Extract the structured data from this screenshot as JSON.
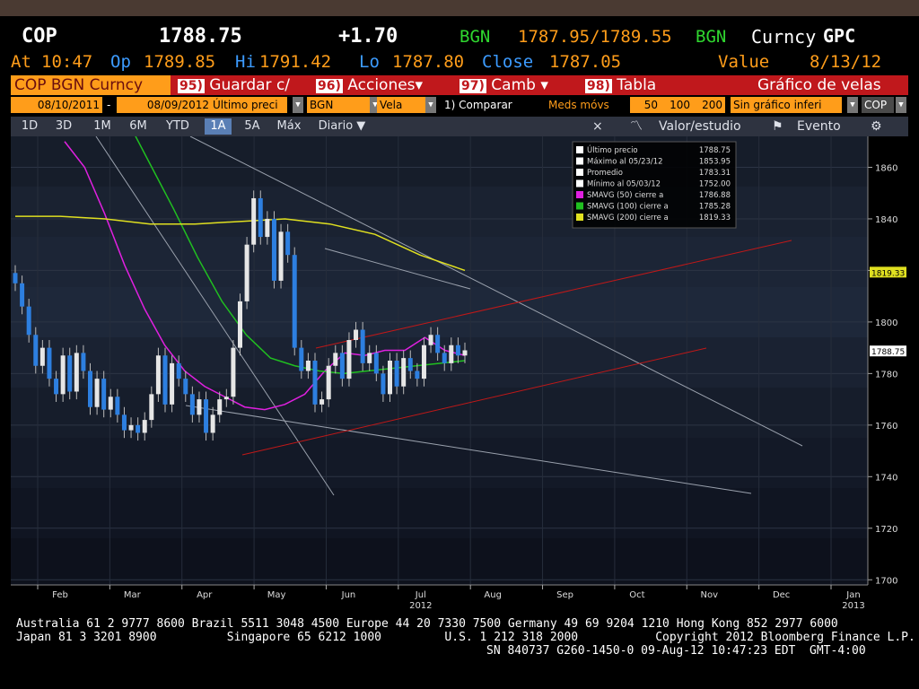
{
  "header": {
    "ticker": "COP",
    "last": "1788.75",
    "change": "+1.70",
    "source1": "BGN",
    "bidask": "1787.95/1789.55",
    "source2": "BGN",
    "curncy": "Curncy",
    "gpc": "GPC",
    "at_label": "At",
    "time": "10:47",
    "op_label": "Op",
    "op": "1789.85",
    "hi_label": "Hi",
    "hi": "1791.42",
    "lo_label": "Lo",
    "lo": "1787.80",
    "close_label": "Close",
    "close": "1787.05",
    "value_label": "Value",
    "date": "8/13/12"
  },
  "menu": {
    "security": "COP BGN Curncy",
    "items": [
      {
        "num": "95)",
        "label": "Guardar c/"
      },
      {
        "num": "96)",
        "label": "Acciones"
      },
      {
        "num": "97)",
        "label": "Camb"
      },
      {
        "num": "98)",
        "label": "Tabla"
      }
    ],
    "title": "Gráfico de velas"
  },
  "controls": {
    "start": "08/10/2011",
    "dash": "-",
    "end": "08/09/2012",
    "field": "Último preci",
    "source": "BGN",
    "style": "Vela",
    "compare": "1) Comparar",
    "mavg_label": "Meds móvs",
    "mavg1": "50",
    "mavg2": "100",
    "mavg3": "200",
    "lower": "Sin gráfico inferi",
    "ccy": "COP"
  },
  "tabs": [
    "1D",
    "3D",
    "1M",
    "6M",
    "YTD",
    "1A",
    "5A",
    "Máx"
  ],
  "selected_tab": "1A",
  "period": "Diario ▼",
  "tools": {
    "value_study": "Valor/estudio",
    "event": "Evento",
    "close": "×"
  },
  "legend": [
    {
      "label": "Último precio",
      "value": "1788.75",
      "color": "#ffffff"
    },
    {
      "label": "Máximo al 05/23/12",
      "value": "1853.95",
      "color": "#ffffff"
    },
    {
      "label": "Promedio",
      "value": "1783.31",
      "color": "#ffffff"
    },
    {
      "label": "Mínimo al 05/03/12",
      "value": "1752.00",
      "color": "#ffffff"
    },
    {
      "label": "SMAVG (50) cierre a",
      "value": "1786.88",
      "color": "#e020e0"
    },
    {
      "label": "SMAVG (100) cierre a",
      "value": "1785.28",
      "color": "#20c020"
    },
    {
      "label": "SMAVG (200) cierre a",
      "value": "1819.33",
      "color": "#e0e020"
    }
  ],
  "chart_data": {
    "type": "candlestick",
    "x_labels": [
      "Feb",
      "Mar",
      "Apr",
      "May",
      "Jun",
      "Jul",
      "Aug",
      "Sep",
      "Oct",
      "Nov",
      "Dec",
      "Jan"
    ],
    "year_labels": {
      "Jul": "2012",
      "Jan": "2013"
    },
    "y_ticks": [
      1700,
      1720,
      1740,
      1760,
      1780,
      1800,
      1820,
      1840,
      1860
    ],
    "ylim": [
      1698,
      1872
    ],
    "last_tag": "1788.75",
    "smavg200_tag": "1819.33",
    "close_series": [
      1815,
      1806,
      1795,
      1783,
      1790,
      1778,
      1772,
      1787,
      1773,
      1788,
      1781,
      1767,
      1778,
      1766,
      1771,
      1764,
      1758,
      1760,
      1757,
      1762,
      1772,
      1787,
      1768,
      1784,
      1778,
      1772,
      1764,
      1770,
      1757,
      1764,
      1770,
      1771,
      1790,
      1808,
      1830,
      1848,
      1833,
      1840,
      1816,
      1835,
      1826,
      1790,
      1781,
      1785,
      1768,
      1770,
      1783,
      1788,
      1778,
      1793,
      1797,
      1784,
      1788,
      1780,
      1772,
      1785,
      1775,
      1786,
      1781,
      1778,
      1791,
      1795,
      1788,
      1784,
      1791,
      1787,
      1789
    ],
    "series": [
      {
        "name": "SMAVG (50)",
        "color": "#e020e0",
        "values": [
          1870,
          1860,
          1842,
          1822,
          1805,
          1791,
          1781,
          1775,
          1771,
          1767,
          1766,
          1768,
          1772,
          1781,
          1788,
          1787,
          1789,
          1789,
          1794,
          1789,
          1787
        ]
      },
      {
        "name": "SMAVG (100)",
        "color": "#20c020",
        "values": [
          1890,
          1880,
          1862,
          1844,
          1825,
          1808,
          1795,
          1786,
          1783,
          1781,
          1780,
          1781,
          1782,
          1783,
          1784,
          1785
        ]
      },
      {
        "name": "SMAVG (200)",
        "color": "#e0e020",
        "values": [
          1841,
          1841,
          1840,
          1838,
          1838,
          1839,
          1840,
          1838,
          1834,
          1826,
          1820
        ]
      }
    ]
  },
  "footer": {
    "line1": "Australia 61 2 9777 8600 Brazil 5511 3048 4500 Europe 44 20 7330 7500 Germany 49 69 9204 1210 Hong Kong 852 2977 6000",
    "line2": "Japan 81 3 3201 8900          Singapore 65 6212 1000         U.S. 1 212 318 2000           Copyright 2012 Bloomberg Finance L.P.",
    "line3": "SN 840737 G260-1450-0 09-Aug-12 10:47:23 EDT  GMT-4:00"
  }
}
